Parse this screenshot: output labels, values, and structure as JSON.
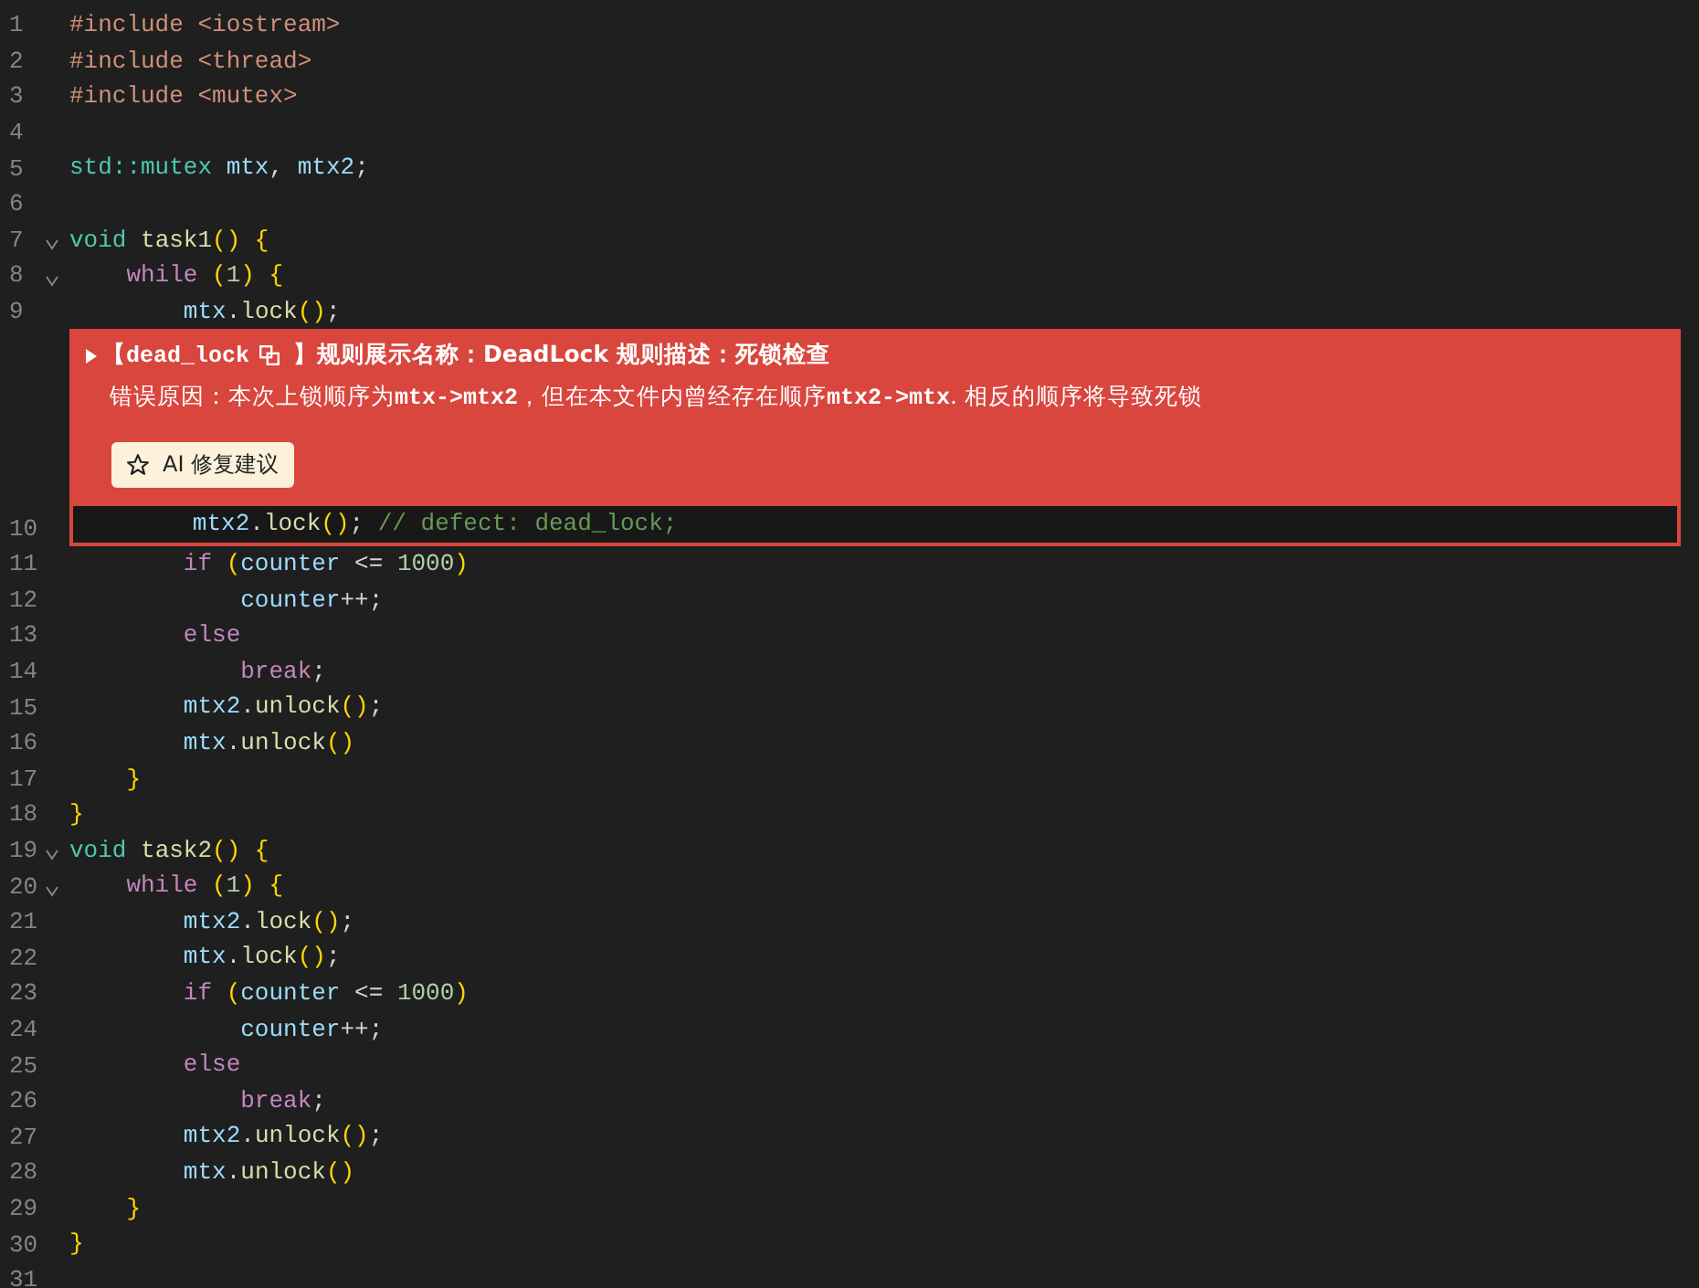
{
  "lines": [
    {
      "number": "1",
      "fold": false,
      "tokens": [
        {
          "text": "#include <iostream>",
          "kind": "preproc"
        }
      ]
    },
    {
      "number": "2",
      "fold": false,
      "tokens": [
        {
          "text": "#include <thread>",
          "kind": "preproc"
        }
      ]
    },
    {
      "number": "3",
      "fold": false,
      "tokens": [
        {
          "text": "#include <mutex>",
          "kind": "preproc"
        }
      ]
    },
    {
      "number": "4",
      "fold": false
    },
    {
      "number": "5",
      "fold": false,
      "tokens": [
        {
          "text": "std::mutex",
          "kind": "type"
        },
        {
          "text": " mtx",
          "kind": "var"
        },
        {
          "text": ", ",
          "kind": "plain"
        },
        {
          "text": "mtx2",
          "kind": "var"
        },
        {
          "text": ";",
          "kind": "plain"
        }
      ]
    },
    {
      "number": "6",
      "fold": false
    },
    {
      "number": "7",
      "fold": true,
      "tokens": [
        {
          "text": "void",
          "kind": "type"
        },
        {
          "text": " task1",
          "kind": "func"
        },
        {
          "text": "() {",
          "kind": "bracket"
        }
      ]
    },
    {
      "number": "8",
      "fold": true,
      "tokens": [
        {
          "text": "    while",
          "kind": "control"
        },
        {
          "text": " (",
          "kind": "bracket"
        },
        {
          "text": "1",
          "kind": "number"
        },
        {
          "text": ") {",
          "kind": "bracket"
        }
      ]
    },
    {
      "number": "9",
      "fold": false,
      "tokens": [
        {
          "text": "        mtx",
          "kind": "var"
        },
        {
          "text": ".",
          "kind": "plain"
        },
        {
          "text": "lock",
          "kind": "func"
        },
        {
          "text": "()",
          "kind": "bracket"
        },
        {
          "text": ";",
          "kind": "plain"
        }
      ]
    },
    {
      "number": "10",
      "fold": false,
      "tokens": [
        {
          "text": "        mtx2",
          "kind": "var"
        },
        {
          "text": ".",
          "kind": "plain"
        },
        {
          "text": "lock",
          "kind": "func"
        },
        {
          "text": "()",
          "kind": "bracket"
        },
        {
          "text": "; ",
          "kind": "plain"
        },
        {
          "text": "// defect: dead_lock;",
          "kind": "comment"
        }
      ],
      "issue": {
        "expanded": false,
        "open_bracket": "【",
        "rule_id": "dead_lock",
        "rule_text": "】规则展示名称：DeadLock 规则描述：死锁检查",
        "message": "错误原因：本次上锁顺序为**mtx->mtx2**，但在本文件内曾经存在顺序**mtx2->mtx**. 相反的顺序将导致死锁",
        "button": "AI 修复建议"
      }
    },
    {
      "number": "11",
      "fold": false,
      "tokens": [
        {
          "text": "        if",
          "kind": "control"
        },
        {
          "text": " (",
          "kind": "bracket"
        },
        {
          "text": "counter",
          "kind": "var"
        },
        {
          "text": " <= ",
          "kind": "plain"
        },
        {
          "text": "1000",
          "kind": "number"
        },
        {
          "text": ")",
          "kind": "bracket"
        }
      ]
    },
    {
      "number": "12",
      "fold": false,
      "tokens": [
        {
          "text": "            counter",
          "kind": "var"
        },
        {
          "text": "++;",
          "kind": "plain"
        }
      ]
    },
    {
      "number": "13",
      "fold": false,
      "tokens": [
        {
          "text": "        else",
          "kind": "control"
        }
      ]
    },
    {
      "number": "14",
      "fold": false,
      "tokens": [
        {
          "text": "            break",
          "kind": "control"
        },
        {
          "text": ";",
          "kind": "plain"
        }
      ]
    },
    {
      "number": "15",
      "fold": false,
      "tokens": [
        {
          "text": "        mtx2",
          "kind": "var"
        },
        {
          "text": ".",
          "kind": "plain"
        },
        {
          "text": "unlock",
          "kind": "func"
        },
        {
          "text": "()",
          "kind": "bracket"
        },
        {
          "text": ";",
          "kind": "plain"
        }
      ]
    },
    {
      "number": "16",
      "fold": false,
      "tokens": [
        {
          "text": "        mtx",
          "kind": "var"
        },
        {
          "text": ".",
          "kind": "plain"
        },
        {
          "text": "unlock",
          "kind": "func"
        },
        {
          "text": "()",
          "kind": "bracket"
        }
      ]
    },
    {
      "number": "17",
      "fold": false,
      "tokens": [
        {
          "text": "    }",
          "kind": "bracket"
        }
      ]
    },
    {
      "number": "18",
      "fold": false,
      "tokens": [
        {
          "text": "}",
          "kind": "bracket"
        }
      ]
    },
    {
      "number": "19",
      "fold": true,
      "tokens": [
        {
          "text": "void",
          "kind": "type"
        },
        {
          "text": " task2",
          "kind": "func"
        },
        {
          "text": "() {",
          "kind": "bracket"
        }
      ]
    },
    {
      "number": "20",
      "fold": true,
      "tokens": [
        {
          "text": "    while",
          "kind": "control"
        },
        {
          "text": " (",
          "kind": "bracket"
        },
        {
          "text": "1",
          "kind": "number"
        },
        {
          "text": ") {",
          "kind": "bracket"
        }
      ]
    },
    {
      "number": "21",
      "fold": false,
      "tokens": [
        {
          "text": "        mtx2",
          "kind": "var"
        },
        {
          "text": ".",
          "kind": "plain"
        },
        {
          "text": "lock",
          "kind": "func"
        },
        {
          "text": "()",
          "kind": "bracket"
        },
        {
          "text": ";",
          "kind": "plain"
        }
      ]
    },
    {
      "number": "22",
      "fold": false,
      "tokens": [
        {
          "text": "        mtx",
          "kind": "var"
        },
        {
          "text": ".",
          "kind": "plain"
        },
        {
          "text": "lock",
          "kind": "func"
        },
        {
          "text": "()",
          "kind": "bracket"
        },
        {
          "text": ";",
          "kind": "plain"
        }
      ]
    },
    {
      "number": "23",
      "fold": false,
      "tokens": [
        {
          "text": "        if",
          "kind": "control"
        },
        {
          "text": " (",
          "kind": "bracket"
        },
        {
          "text": "counter",
          "kind": "var"
        },
        {
          "text": " <= ",
          "kind": "plain"
        },
        {
          "text": "1000",
          "kind": "number"
        },
        {
          "text": ")",
          "kind": "bracket"
        }
      ]
    },
    {
      "number": "24",
      "fold": false,
      "tokens": [
        {
          "text": "            counter",
          "kind": "var"
        },
        {
          "text": "++;",
          "kind": "plain"
        }
      ]
    },
    {
      "number": "25",
      "fold": false,
      "tokens": [
        {
          "text": "        else",
          "kind": "control"
        }
      ]
    },
    {
      "number": "26",
      "fold": false,
      "tokens": [
        {
          "text": "            break",
          "kind": "control"
        },
        {
          "text": ";",
          "kind": "plain"
        }
      ]
    },
    {
      "number": "27",
      "fold": false,
      "tokens": [
        {
          "text": "        mtx2",
          "kind": "var"
        },
        {
          "text": ".",
          "kind": "plain"
        },
        {
          "text": "unlock",
          "kind": "func"
        },
        {
          "text": "()",
          "kind": "bracket"
        },
        {
          "text": ";",
          "kind": "plain"
        }
      ]
    },
    {
      "number": "28",
      "fold": false,
      "tokens": [
        {
          "text": "        mtx",
          "kind": "var"
        },
        {
          "text": ".",
          "kind": "plain"
        },
        {
          "text": "unlock",
          "kind": "func"
        },
        {
          "text": "()",
          "kind": "bracket"
        }
      ]
    },
    {
      "number": "29",
      "fold": false,
      "tokens": [
        {
          "text": "    }",
          "kind": "bracket"
        }
      ]
    },
    {
      "number": "30",
      "fold": false,
      "tokens": [
        {
          "text": "}",
          "kind": "bracket"
        }
      ]
    },
    {
      "number": "31",
      "fold": false
    }
  ]
}
